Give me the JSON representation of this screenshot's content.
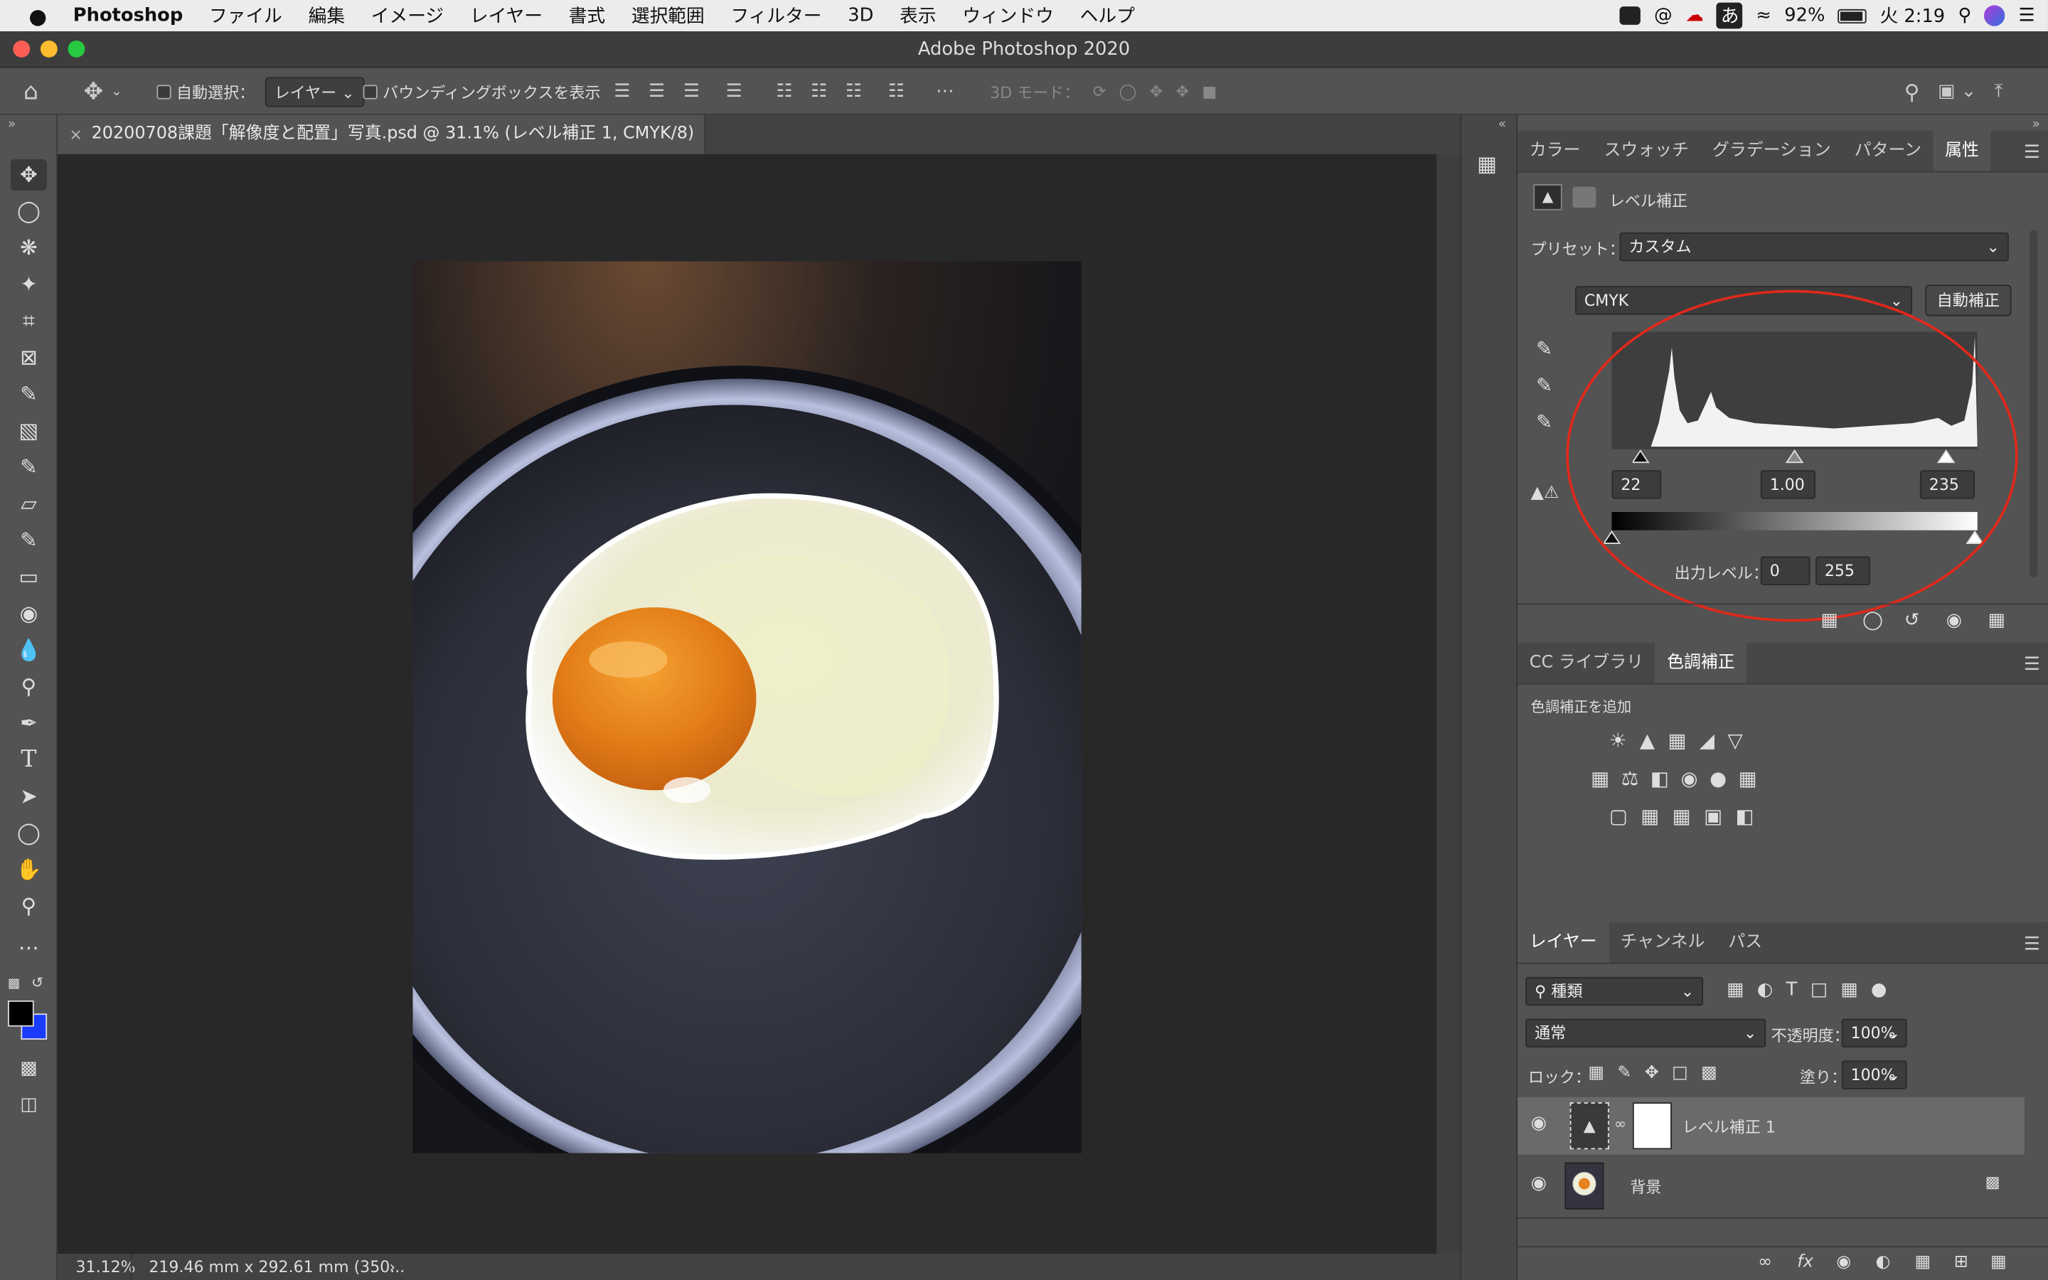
{
  "menubar": {
    "apple": "",
    "items": [
      "Photoshop",
      "ファイル",
      "編集",
      "イメージ",
      "レイヤー",
      "書式",
      "選択範囲",
      "フィルター",
      "3D",
      "表示",
      "ウィンドウ",
      "ヘルプ"
    ],
    "battery": "92%",
    "clock": "火 2:19",
    "ime": "あ"
  },
  "window": {
    "title": "Adobe Photoshop 2020"
  },
  "options": {
    "auto_select_label": "自動選択：",
    "auto_select_value": "レイヤー",
    "bbox_label": "バウンディングボックスを表示",
    "mode3d_label": "3D モード："
  },
  "document": {
    "tab_title": "20200708課題「解像度と配置」写真.psd @ 31.1% (レベル補正 1, CMYK/8)",
    "close_icon": "×"
  },
  "status": {
    "zoom": "31.12%",
    "size": "219.46 mm x 292.61 mm (350...",
    "arrow": "›"
  },
  "properties": {
    "tabs": [
      "カラー",
      "スウォッチ",
      "グラデーション",
      "パターン",
      "属性"
    ],
    "active_tab": "属性",
    "panel_title": "レベル補正",
    "preset_label": "プリセット：",
    "preset_value": "カスタム",
    "channel_value": "CMYK",
    "auto_button": "自動補正",
    "input_black": "22",
    "input_gamma": "1.00",
    "input_white": "235",
    "output_label": "出力レベル：",
    "output_black": "0",
    "output_white": "255",
    "annotation_color": "#e0291b"
  },
  "adjustments": {
    "tabs": [
      "CC ライブラリ",
      "色調補正"
    ],
    "active_tab": "色調補正",
    "add_label": "色調補正を追加"
  },
  "layers": {
    "tabs": [
      "レイヤー",
      "チャンネル",
      "パス"
    ],
    "active_tab": "レイヤー",
    "filter_label": "種類",
    "blend_mode": "通常",
    "opacity_label": "不透明度：",
    "opacity_value": "100%",
    "lock_label": "ロック：",
    "fill_label": "塗り：",
    "fill_value": "100%",
    "items": [
      {
        "name": "レベル補正 1",
        "selected": true
      },
      {
        "name": "背景",
        "selected": false
      }
    ]
  },
  "toolbar_icons": [
    "move-icon",
    "marquee-icon",
    "lasso-icon",
    "magic-wand-icon",
    "crop-icon",
    "frame-icon",
    "eyedropper-icon",
    "healing-brush-icon",
    "brush-icon",
    "stamp-icon",
    "history-brush-icon",
    "eraser-icon",
    "paint-bucket-icon",
    "blur-icon",
    "dodge-icon",
    "pen-icon",
    "type-icon",
    "path-selection-icon",
    "ellipse-icon",
    "hand-icon",
    "zoom-icon",
    "more-tools-icon"
  ],
  "colors": {
    "foreground": "#000000",
    "background": "#1a3cff",
    "accent_annotation": "#e0291b"
  }
}
